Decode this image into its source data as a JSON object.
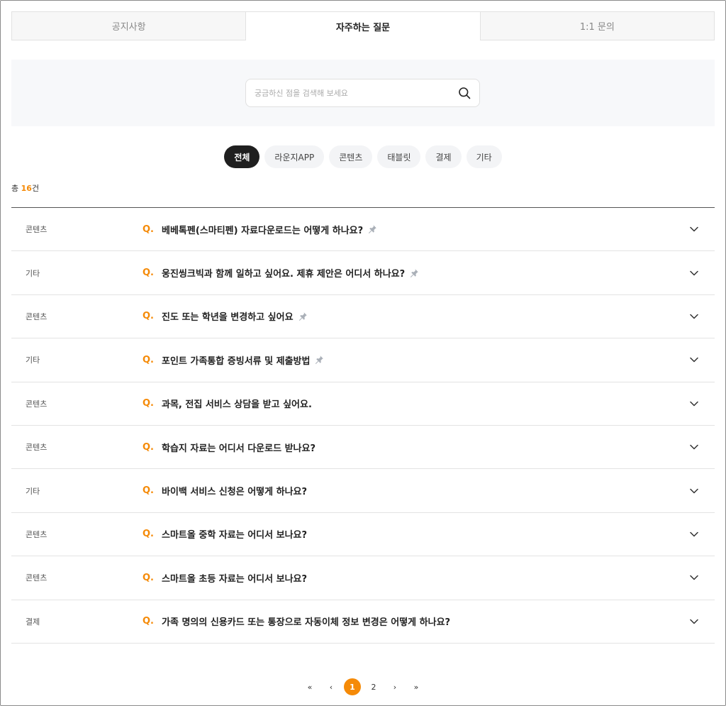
{
  "tabs": [
    {
      "label": "공지사항",
      "active": false
    },
    {
      "label": "자주하는 질문",
      "active": true
    },
    {
      "label": "1:1 문의",
      "active": false
    }
  ],
  "search": {
    "placeholder": "궁금하신 점을 검색해 보세요",
    "value": ""
  },
  "categories": [
    {
      "label": "전체",
      "active": true
    },
    {
      "label": "라운지APP",
      "active": false
    },
    {
      "label": "콘텐츠",
      "active": false
    },
    {
      "label": "태블릿",
      "active": false
    },
    {
      "label": "결제",
      "active": false
    },
    {
      "label": "기타",
      "active": false
    }
  ],
  "count": {
    "prefix": "총 ",
    "number": "16",
    "suffix": "건"
  },
  "q_marker": "Q.",
  "faqs": [
    {
      "category": "콘텐츠",
      "title": "베베톡펜(스마티펜) 자료다운로드는 어떻게 하나요?",
      "pinned": true
    },
    {
      "category": "기타",
      "title": "웅진씽크빅과 함께 일하고 싶어요. 제휴 제안은 어디서 하나요?",
      "pinned": true
    },
    {
      "category": "콘텐츠",
      "title": "진도 또는 학년을 변경하고 싶어요",
      "pinned": true
    },
    {
      "category": "기타",
      "title": "포인트 가족통합 증빙서류 및 제출방법",
      "pinned": true
    },
    {
      "category": "콘텐츠",
      "title": "과목, 전집 서비스 상담을 받고 싶어요.",
      "pinned": false
    },
    {
      "category": "콘텐츠",
      "title": "학습지 자료는 어디서 다운로드 받나요?",
      "pinned": false
    },
    {
      "category": "기타",
      "title": "바이백 서비스 신청은 어떻게 하나요?",
      "pinned": false
    },
    {
      "category": "콘텐츠",
      "title": "스마트올 중학 자료는 어디서 보나요?",
      "pinned": false
    },
    {
      "category": "콘텐츠",
      "title": "스마트올 초등 자료는 어디서 보나요?",
      "pinned": false
    },
    {
      "category": "결제",
      "title": "가족 명의의 신용카드 또는 통장으로 자동이체 정보 변경은 어떻게 하나요?",
      "pinned": false
    }
  ],
  "pagination": {
    "first": "«",
    "prev": "‹",
    "pages": [
      "1",
      "2"
    ],
    "current": "1",
    "next": "›",
    "last": "»"
  },
  "colors": {
    "accent": "#f58a07",
    "chip_active": "#1f1f1f"
  }
}
